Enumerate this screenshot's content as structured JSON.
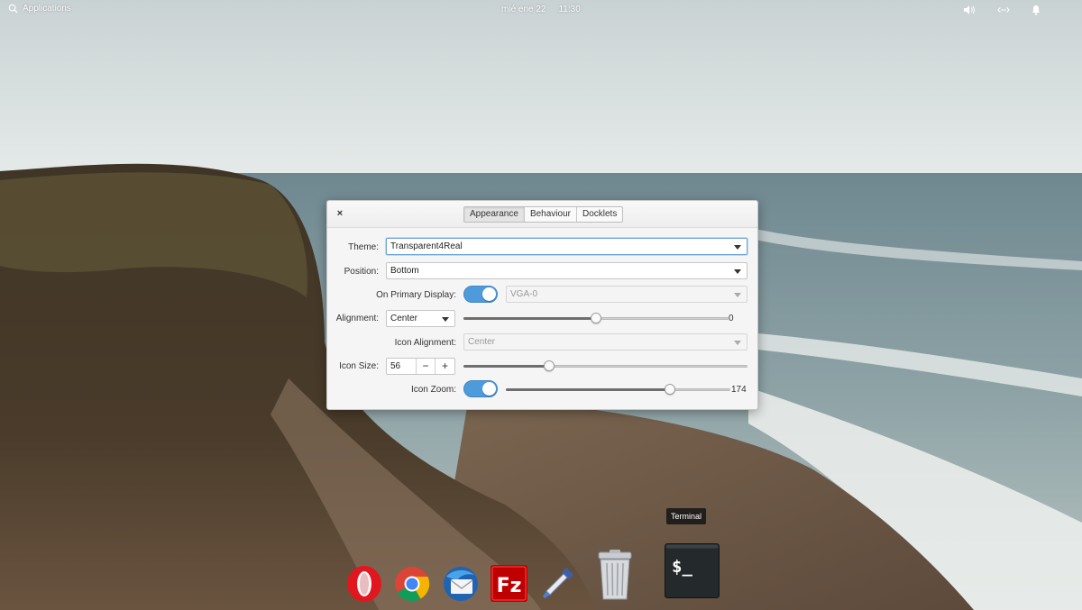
{
  "top_panel": {
    "applications_label": "Applications",
    "date": "mié ene 22",
    "time": "11:30",
    "indicators": [
      "sound-icon",
      "network-icon",
      "notifications-icon"
    ]
  },
  "dialog": {
    "close_glyph": "×",
    "tabs": [
      {
        "label": "Appearance",
        "active": true
      },
      {
        "label": "Behaviour",
        "active": false
      },
      {
        "label": "Docklets",
        "active": false
      }
    ],
    "theme": {
      "label": "Theme:",
      "value": "Transparent4Real"
    },
    "position": {
      "label": "Position:",
      "value": "Bottom"
    },
    "primary_display": {
      "label": "On Primary Display:",
      "enabled": true,
      "monitor_value": "VGA-0"
    },
    "alignment": {
      "label": "Alignment:",
      "value": "Center",
      "offset_value": "0",
      "offset_fraction": 0.5
    },
    "icon_alignment": {
      "label": "Icon Alignment:",
      "value": "Center"
    },
    "icon_size": {
      "label": "Icon Size:",
      "value": "56",
      "minus": "−",
      "plus": "+",
      "slider_fraction": 0.3
    },
    "icon_zoom": {
      "label": "Icon Zoom:",
      "enabled": true,
      "value": "174",
      "slider_fraction": 0.73
    }
  },
  "dock": {
    "items": [
      "opera-icon",
      "chrome-icon",
      "thunderbird-icon",
      "filezilla-icon",
      "color-picker-icon",
      "trash-icon",
      "terminal-icon"
    ],
    "tooltip": "Terminal",
    "terminal_glyph": "$_",
    "filezilla_glyph": "Fz"
  },
  "colors": {
    "accent": "#4e9bdc",
    "focus": "#6ba3d8"
  }
}
